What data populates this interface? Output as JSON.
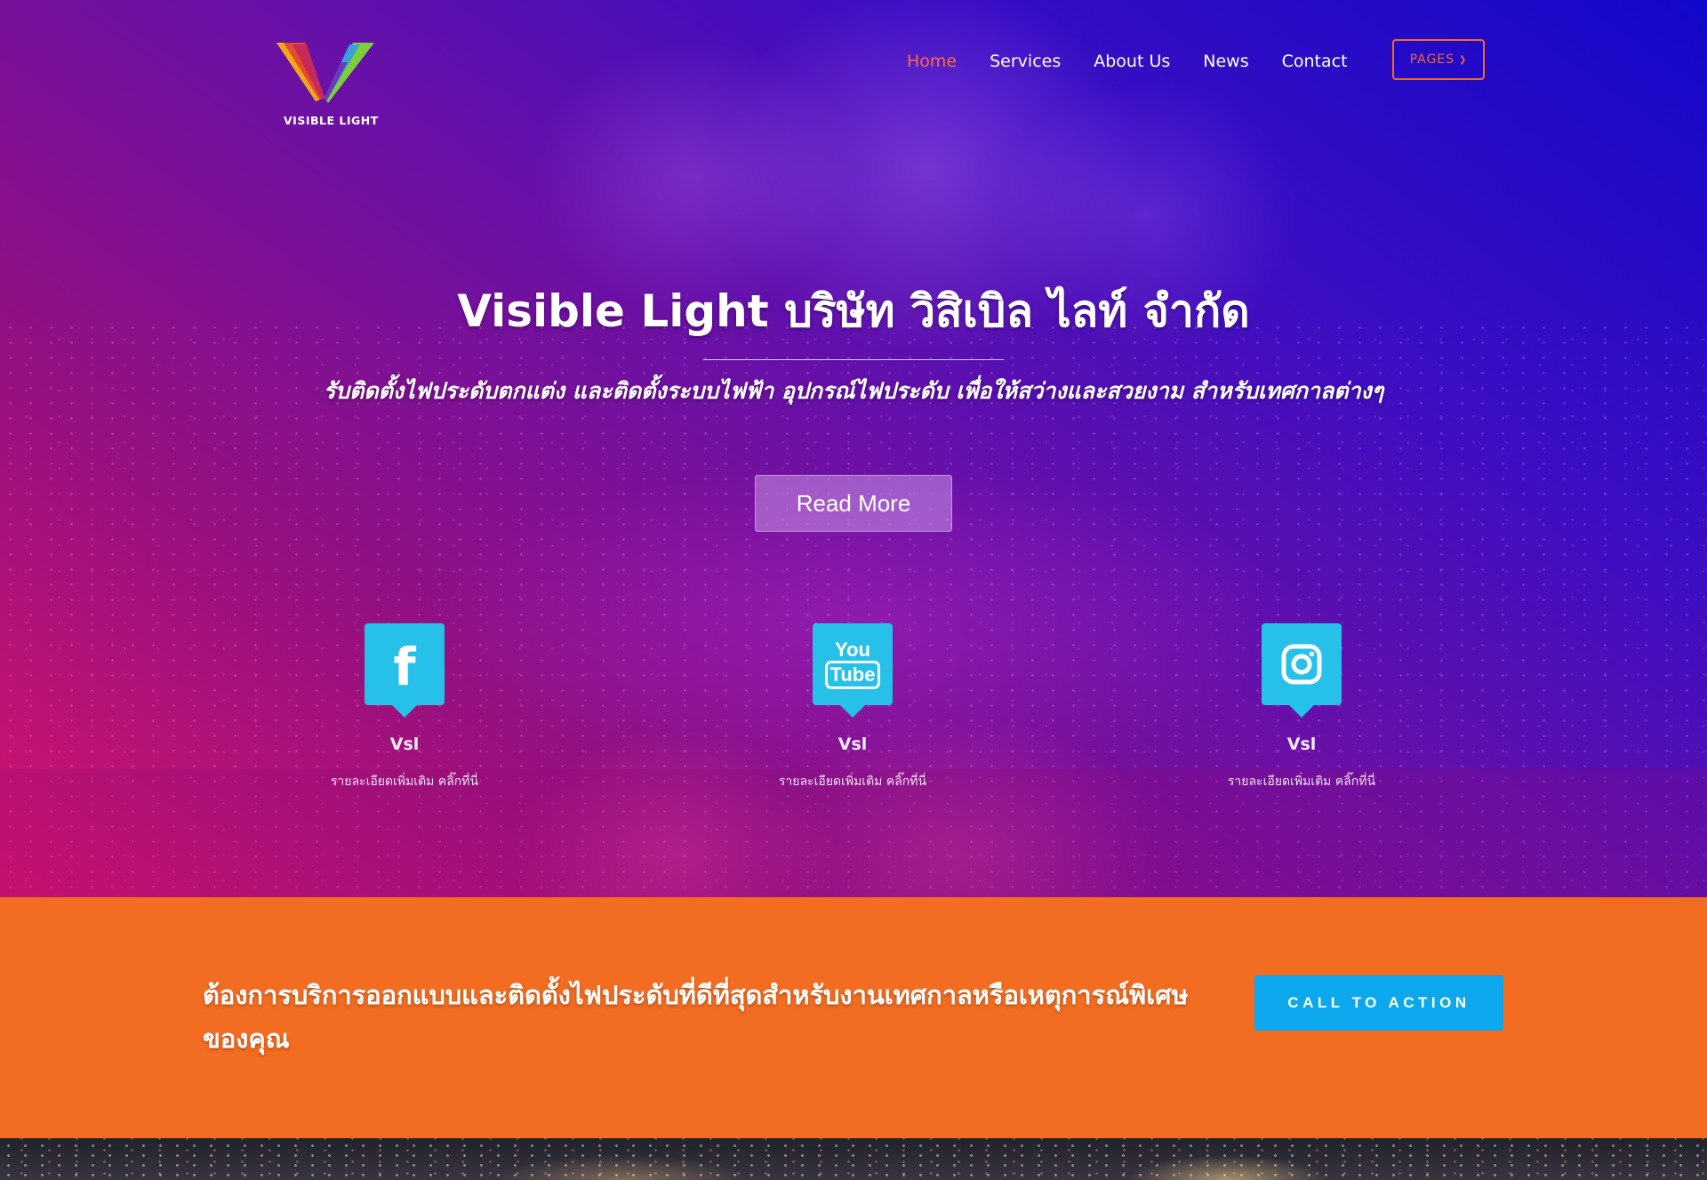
{
  "header": {
    "logo_text": "VISIBLE LIGHT",
    "nav": [
      "Home",
      "Services",
      "About Us",
      "News",
      "Contact"
    ],
    "active_nav": "Home",
    "pages_button": "PAGES"
  },
  "hero": {
    "title": "Visible Light บริษัท วิสิเบิล ไลท์ จำกัด",
    "subtitle": "รับติดตั้งไฟประดับตกแต่ง และติดตั้งระบบไฟฟ้า อุปกรณ์ไฟประดับ เพื่อให้สว่างและสวยงาม สำหรับเทศกาลต่างๆ",
    "read_more": "Read More"
  },
  "features": [
    {
      "icon": "facebook-icon",
      "name": "Vsl",
      "desc": "รายละเอียดเพิ่มเติม คลิ๊กที่นี่"
    },
    {
      "icon": "youtube-icon",
      "name": "Vsl",
      "desc": "รายละเอียดเพิ่มเติม คลิ๊กที่นี่",
      "icon_text_top": "You",
      "icon_text_bottom": "Tube"
    },
    {
      "icon": "instagram-icon",
      "name": "Vsl",
      "desc": "รายละเอียดเพิ่มเติม คลิ๊กที่นี่"
    }
  ],
  "cta": {
    "text": "ต้องการบริการออกแบบและติดตั้งไฟประดับที่ดีที่สุดสำหรับงานเทศกาลหรือเหตุการณ์พิเศษของคุณ",
    "button": "CALL TO ACTION"
  },
  "colors": {
    "accent_orange": "#f26c21",
    "nav_active": "#ff6a39",
    "icon_box": "#27c0e8",
    "cta_button": "#0ca7ec"
  }
}
